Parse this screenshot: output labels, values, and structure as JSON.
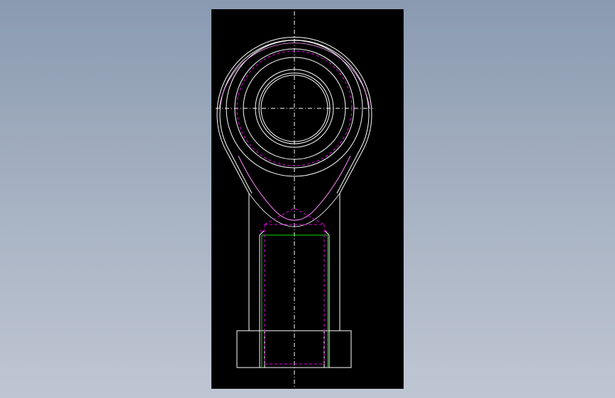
{
  "colors": {
    "background_top": "#8a9ab0",
    "background_bottom": "#bfc6d3",
    "sheet": "#000000",
    "outline": "#ffffff",
    "hidden_line": "#e000e0",
    "thread_line": "#00e000",
    "center_line": "#ffffff",
    "edge_highlight": "#ff99ff"
  },
  "drawing": {
    "view": "front",
    "part": "rod-end-bearing"
  }
}
